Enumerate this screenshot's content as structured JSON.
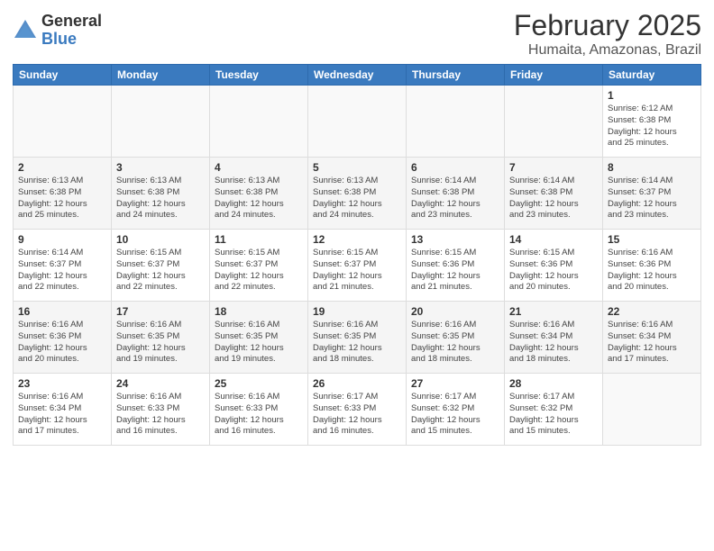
{
  "logo": {
    "general": "General",
    "blue": "Blue"
  },
  "title": "February 2025",
  "subtitle": "Humaita, Amazonas, Brazil",
  "days_of_week": [
    "Sunday",
    "Monday",
    "Tuesday",
    "Wednesday",
    "Thursday",
    "Friday",
    "Saturday"
  ],
  "weeks": [
    [
      {
        "day": "",
        "info": ""
      },
      {
        "day": "",
        "info": ""
      },
      {
        "day": "",
        "info": ""
      },
      {
        "day": "",
        "info": ""
      },
      {
        "day": "",
        "info": ""
      },
      {
        "day": "",
        "info": ""
      },
      {
        "day": "1",
        "info": "Sunrise: 6:12 AM\nSunset: 6:38 PM\nDaylight: 12 hours\nand 25 minutes."
      }
    ],
    [
      {
        "day": "2",
        "info": "Sunrise: 6:13 AM\nSunset: 6:38 PM\nDaylight: 12 hours\nand 25 minutes."
      },
      {
        "day": "3",
        "info": "Sunrise: 6:13 AM\nSunset: 6:38 PM\nDaylight: 12 hours\nand 24 minutes."
      },
      {
        "day": "4",
        "info": "Sunrise: 6:13 AM\nSunset: 6:38 PM\nDaylight: 12 hours\nand 24 minutes."
      },
      {
        "day": "5",
        "info": "Sunrise: 6:13 AM\nSunset: 6:38 PM\nDaylight: 12 hours\nand 24 minutes."
      },
      {
        "day": "6",
        "info": "Sunrise: 6:14 AM\nSunset: 6:38 PM\nDaylight: 12 hours\nand 23 minutes."
      },
      {
        "day": "7",
        "info": "Sunrise: 6:14 AM\nSunset: 6:38 PM\nDaylight: 12 hours\nand 23 minutes."
      },
      {
        "day": "8",
        "info": "Sunrise: 6:14 AM\nSunset: 6:37 PM\nDaylight: 12 hours\nand 23 minutes."
      }
    ],
    [
      {
        "day": "9",
        "info": "Sunrise: 6:14 AM\nSunset: 6:37 PM\nDaylight: 12 hours\nand 22 minutes."
      },
      {
        "day": "10",
        "info": "Sunrise: 6:15 AM\nSunset: 6:37 PM\nDaylight: 12 hours\nand 22 minutes."
      },
      {
        "day": "11",
        "info": "Sunrise: 6:15 AM\nSunset: 6:37 PM\nDaylight: 12 hours\nand 22 minutes."
      },
      {
        "day": "12",
        "info": "Sunrise: 6:15 AM\nSunset: 6:37 PM\nDaylight: 12 hours\nand 21 minutes."
      },
      {
        "day": "13",
        "info": "Sunrise: 6:15 AM\nSunset: 6:36 PM\nDaylight: 12 hours\nand 21 minutes."
      },
      {
        "day": "14",
        "info": "Sunrise: 6:15 AM\nSunset: 6:36 PM\nDaylight: 12 hours\nand 20 minutes."
      },
      {
        "day": "15",
        "info": "Sunrise: 6:16 AM\nSunset: 6:36 PM\nDaylight: 12 hours\nand 20 minutes."
      }
    ],
    [
      {
        "day": "16",
        "info": "Sunrise: 6:16 AM\nSunset: 6:36 PM\nDaylight: 12 hours\nand 20 minutes."
      },
      {
        "day": "17",
        "info": "Sunrise: 6:16 AM\nSunset: 6:35 PM\nDaylight: 12 hours\nand 19 minutes."
      },
      {
        "day": "18",
        "info": "Sunrise: 6:16 AM\nSunset: 6:35 PM\nDaylight: 12 hours\nand 19 minutes."
      },
      {
        "day": "19",
        "info": "Sunrise: 6:16 AM\nSunset: 6:35 PM\nDaylight: 12 hours\nand 18 minutes."
      },
      {
        "day": "20",
        "info": "Sunrise: 6:16 AM\nSunset: 6:35 PM\nDaylight: 12 hours\nand 18 minutes."
      },
      {
        "day": "21",
        "info": "Sunrise: 6:16 AM\nSunset: 6:34 PM\nDaylight: 12 hours\nand 18 minutes."
      },
      {
        "day": "22",
        "info": "Sunrise: 6:16 AM\nSunset: 6:34 PM\nDaylight: 12 hours\nand 17 minutes."
      }
    ],
    [
      {
        "day": "23",
        "info": "Sunrise: 6:16 AM\nSunset: 6:34 PM\nDaylight: 12 hours\nand 17 minutes."
      },
      {
        "day": "24",
        "info": "Sunrise: 6:16 AM\nSunset: 6:33 PM\nDaylight: 12 hours\nand 16 minutes."
      },
      {
        "day": "25",
        "info": "Sunrise: 6:16 AM\nSunset: 6:33 PM\nDaylight: 12 hours\nand 16 minutes."
      },
      {
        "day": "26",
        "info": "Sunrise: 6:17 AM\nSunset: 6:33 PM\nDaylight: 12 hours\nand 16 minutes."
      },
      {
        "day": "27",
        "info": "Sunrise: 6:17 AM\nSunset: 6:32 PM\nDaylight: 12 hours\nand 15 minutes."
      },
      {
        "day": "28",
        "info": "Sunrise: 6:17 AM\nSunset: 6:32 PM\nDaylight: 12 hours\nand 15 minutes."
      },
      {
        "day": "",
        "info": ""
      }
    ]
  ]
}
